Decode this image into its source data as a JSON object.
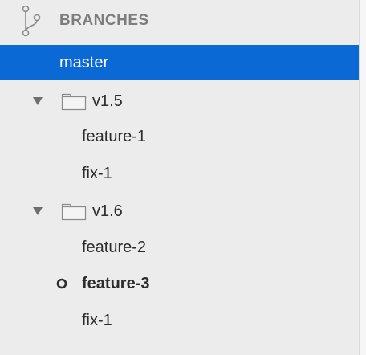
{
  "header": {
    "title": "BRANCHES",
    "icon": "git-branch-icon"
  },
  "colors": {
    "selection": "#0b69d6",
    "header_text": "#7d7d7d",
    "text": "#2c2c2c",
    "background": "#ececec"
  },
  "tree": {
    "master": "master",
    "folders": [
      {
        "label": "v1.5",
        "expanded": true,
        "branches": [
          "feature-1",
          "fix-1"
        ]
      },
      {
        "label": "v1.6",
        "expanded": true,
        "branches": [
          "feature-2",
          "feature-3",
          "fix-1"
        ]
      }
    ],
    "selected": "master",
    "current": "feature-3"
  }
}
